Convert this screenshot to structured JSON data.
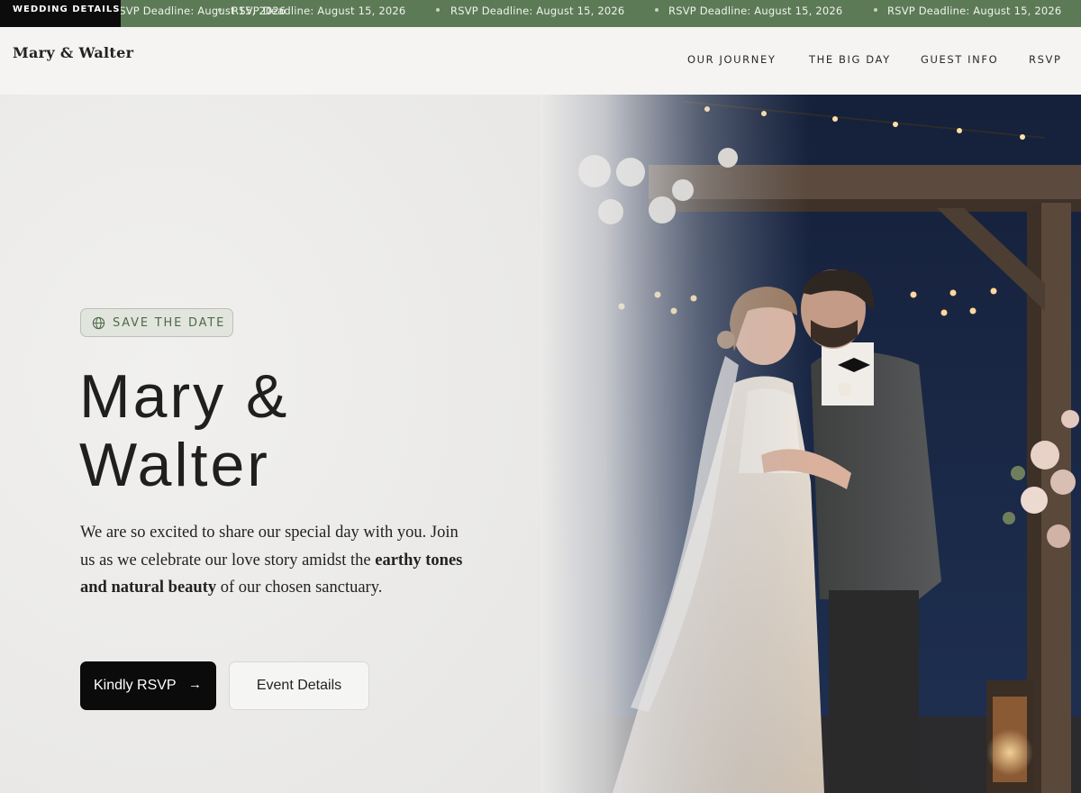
{
  "ticker": {
    "label": "WEDDING DETAILS",
    "items": [
      "RSVP Deadline: August 15, 2026",
      "RSVP Deadline: August 15, 2026",
      "RSVP Deadline: August 15, 2026",
      "RSVP Deadline: August 15, 2026",
      "RSVP Deadline: August 15, 2026"
    ]
  },
  "header": {
    "logo": "Mary & Walter",
    "nav": [
      "OUR JOURNEY",
      "THE BIG DAY",
      "GUEST INFO",
      "RSVP"
    ]
  },
  "hero": {
    "badge": "SAVE THE DATE",
    "badge_icon": "globe-icon",
    "title_line1": "Mary &",
    "title_line2": "Walter",
    "desc_part1": "We are so excited to share our special day with you. Join us as we celebrate our love story amidst the ",
    "desc_bold": "earthy tones and natural beauty",
    "desc_part2": " of our chosen sanctuary.",
    "primary_button": "Kindly RSVP",
    "primary_icon": "arrow-right-icon",
    "secondary_button": "Event Details"
  },
  "colors": {
    "ticker_bg": "#5c7a56",
    "accent_green": "#4e6a48",
    "button_dark": "#0b0b0b",
    "page_bg": "#f5f4f2"
  }
}
